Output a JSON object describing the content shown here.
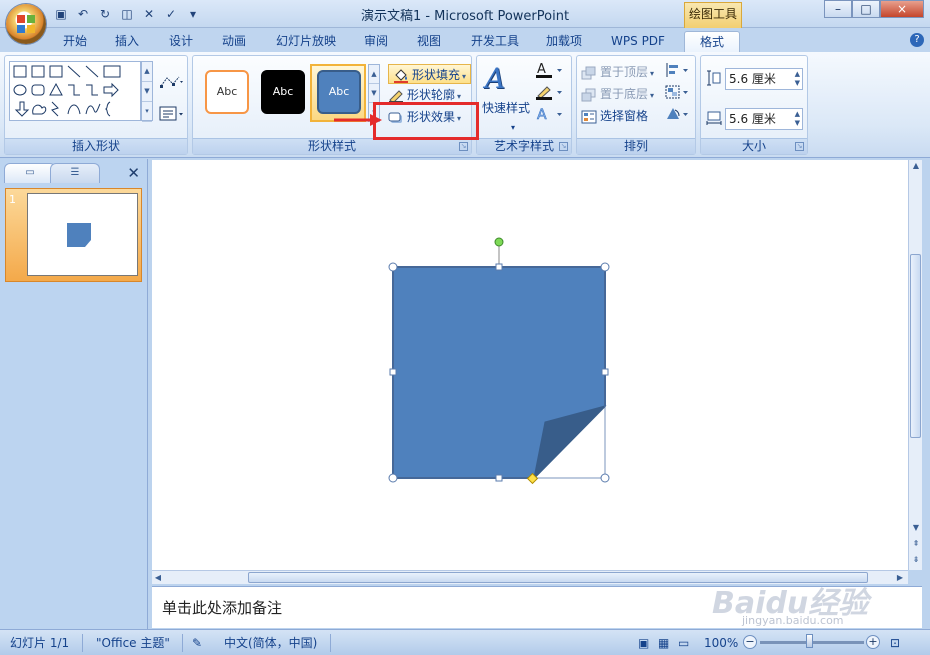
{
  "window": {
    "title": "演示文稿1 - Microsoft PowerPoint",
    "context_tool": "绘图工具",
    "controls": [
      "–",
      "□",
      "×"
    ]
  },
  "tabs": [
    {
      "label": "开始"
    },
    {
      "label": "插入"
    },
    {
      "label": "设计"
    },
    {
      "label": "动画"
    },
    {
      "label": "幻灯片放映"
    },
    {
      "label": "审阅"
    },
    {
      "label": "视图"
    },
    {
      "label": "开发工具"
    },
    {
      "label": "加载项"
    },
    {
      "label": "WPS PDF"
    },
    {
      "label": "格式",
      "active": true
    }
  ],
  "ribbon": {
    "groups": {
      "insert_shapes": "插入形状",
      "shape_styles": "形状样式",
      "wordart_styles": "艺术字样式",
      "arrange": "排列",
      "size": "大小"
    },
    "style_samples": [
      "Abc",
      "Abc",
      "Abc"
    ],
    "shape_fill": "形状填充",
    "shape_outline": "形状轮廓",
    "shape_effects": "形状效果",
    "quick_styles": "快速样式",
    "bring_front": "置于顶层",
    "send_back": "置于底层",
    "selection_pane": "选择窗格",
    "height": "5.6 厘米",
    "width": "5.6 厘米"
  },
  "slides_panel": {
    "slide_number": "1"
  },
  "notes_placeholder": "单击此处添加备注",
  "status": {
    "slide": "幻灯片 1/1",
    "theme": "\"Office 主题\"",
    "language": "中文(简体，中国)",
    "zoom": "100%"
  },
  "watermark": {
    "text": "Baidu经验",
    "sub": "jingyan.baidu.com"
  },
  "colors": {
    "shape_fill": "#4f81bd",
    "shape_fold": "#385d8a",
    "highlight_box": "#e42b2b",
    "active_tab": "#ffffff"
  }
}
